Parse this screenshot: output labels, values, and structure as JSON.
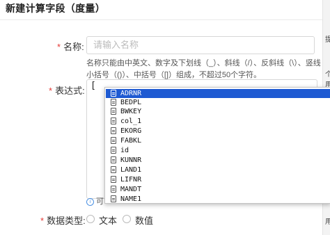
{
  "dialog": {
    "title": "新建计算字段（度量）"
  },
  "form": {
    "name": {
      "required_mark": "*",
      "label": "名称:",
      "placeholder": "请输入名称",
      "hint_line1": "名称只能由中英文、数字及下划线（_）、斜线（/）、反斜线（\\）、竖线（|）、",
      "hint_line2": "小括号（()）、中括号（[]）组成，不超过50个字符。"
    },
    "expression": {
      "required_mark": "*",
      "label": "表达式:",
      "value": "[",
      "tip_partial": "可"
    },
    "data_type": {
      "required_mark": "*",
      "label": "数据类型:",
      "options": [
        "文本",
        "数值"
      ]
    }
  },
  "autocomplete": {
    "selected_index": 0,
    "items": [
      "ADRNR",
      "BEDPL",
      "BWKEY",
      "col_1",
      "EKORG",
      "FABKL",
      "id",
      "KUNNR",
      "LAND1",
      "LIFNR",
      "MANDT",
      "NAME1"
    ],
    "icon": "document-field-icon",
    "highlight_color": "#1e5ad2"
  },
  "side": {
    "label_top": "提",
    "label_mid1": "个",
    "label_mid2": "用",
    "label_bottom": "用"
  }
}
